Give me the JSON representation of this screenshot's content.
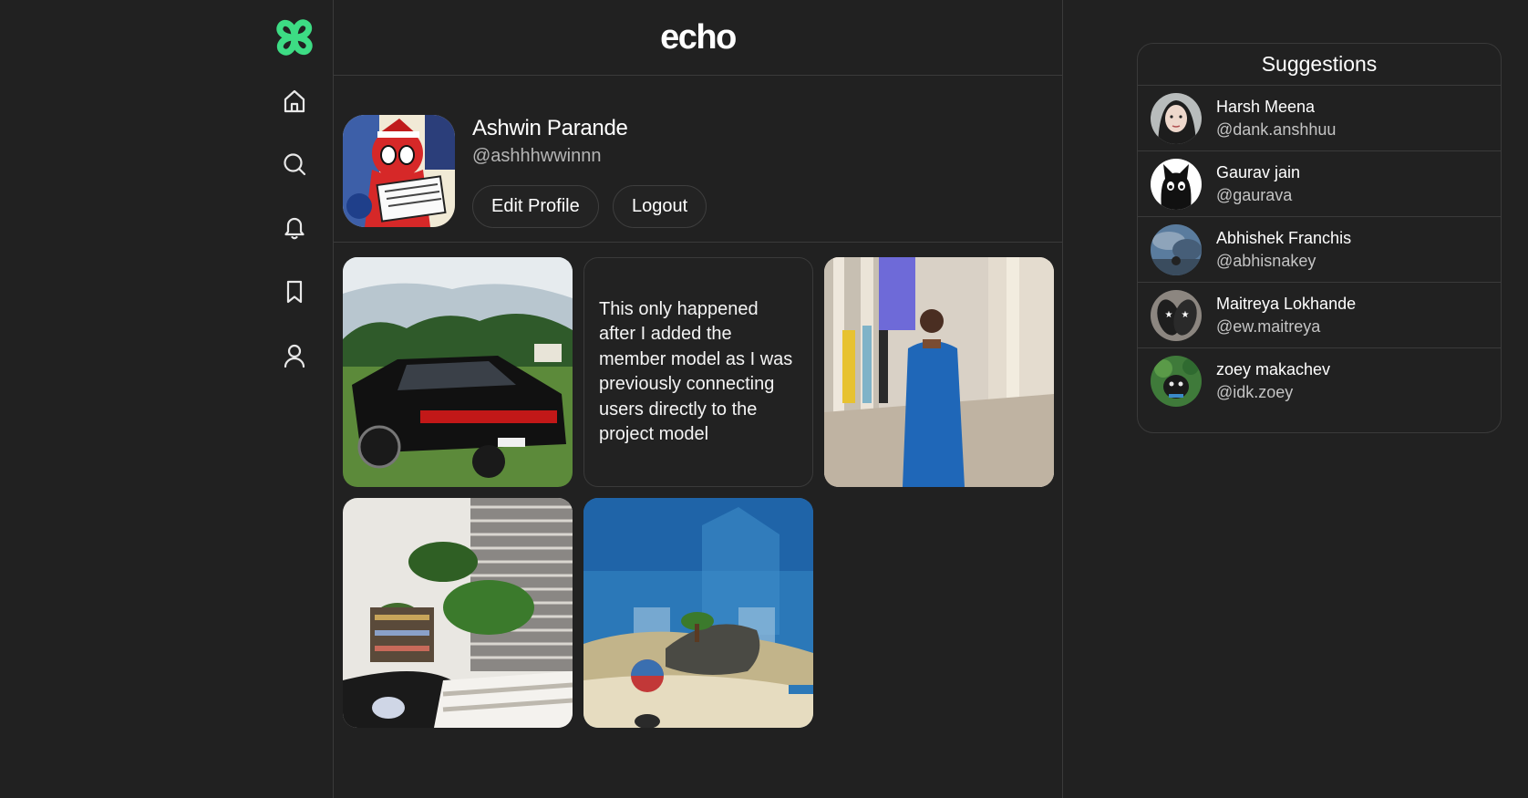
{
  "app": {
    "brand_title": "echo",
    "accent_color": "#3ddc84",
    "background_color": "#212121"
  },
  "nav": {
    "items": [
      {
        "name": "home",
        "icon": "home-icon"
      },
      {
        "name": "search",
        "icon": "search-icon"
      },
      {
        "name": "notifications",
        "icon": "bell-icon"
      },
      {
        "name": "bookmarks",
        "icon": "bookmark-icon"
      },
      {
        "name": "profile",
        "icon": "user-icon"
      }
    ]
  },
  "profile": {
    "name": "Ashwin Parande",
    "handle": "@ashhhwwinnn",
    "edit_label": "Edit Profile",
    "logout_label": "Logout",
    "avatar": "comic-hero-avatar"
  },
  "posts": [
    {
      "type": "image",
      "subject": "black sedan on grass"
    },
    {
      "type": "text",
      "text": "This only happened after I added the member model as I was previously connecting users directly to the project model"
    },
    {
      "type": "image",
      "subject": "man in blue kurta in hallway"
    },
    {
      "type": "image",
      "subject": "room with plants by window"
    },
    {
      "type": "image",
      "subject": "anime beach scene"
    }
  ],
  "suggestions": {
    "title": "Suggestions",
    "users": [
      {
        "name": "Harsh Meena",
        "handle": "@dank.anshhuu"
      },
      {
        "name": "Gaurav jain",
        "handle": "@gaurava"
      },
      {
        "name": "Abhishek Franchis",
        "handle": "@abhisnakey"
      },
      {
        "name": "Maitreya Lokhande",
        "handle": "@ew.maitreya"
      },
      {
        "name": "zoey makachev",
        "handle": "@idk.zoey"
      }
    ]
  }
}
